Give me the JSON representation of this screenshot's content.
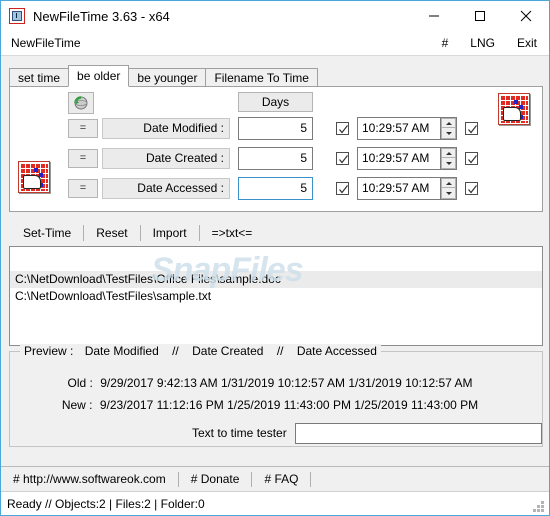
{
  "window": {
    "title": "NewFileTime 3.63 - x64",
    "app_icon": "clock-calendar-icon",
    "minimize": "minimize-icon",
    "maximize": "maximize-icon",
    "close": "close-icon"
  },
  "menubar": {
    "app_name": "NewFileTime",
    "items": [
      {
        "label": "#",
        "name": "menu-hash"
      },
      {
        "label": "LNG",
        "name": "menu-language"
      },
      {
        "label": "Exit",
        "name": "menu-exit"
      }
    ]
  },
  "tabs": [
    {
      "label": "set time",
      "active": false
    },
    {
      "label": "be older",
      "active": true
    },
    {
      "label": "be younger",
      "active": false
    },
    {
      "label": "Filename To Time",
      "active": false
    }
  ],
  "panel": {
    "refresh_icon": "globe-refresh-icon",
    "days_header": "Days",
    "calendar_icon_top_right": "calendar-hand-icon",
    "calendar_icon_bottom_left": "calendar-hand-icon",
    "rows": [
      {
        "equals_label": "=",
        "field_label": "Date Modified :",
        "days_value": "5",
        "days_focused": false,
        "time_checkbox_checked": true,
        "time_value": "10:29:57 AM",
        "apply_checkbox_checked": true
      },
      {
        "equals_label": "=",
        "field_label": "Date Created :",
        "days_value": "5",
        "days_focused": false,
        "time_checkbox_checked": true,
        "time_value": "10:29:57 AM",
        "apply_checkbox_checked": true
      },
      {
        "equals_label": "=",
        "field_label": "Date Accessed :",
        "days_value": "5",
        "days_focused": true,
        "time_checkbox_checked": true,
        "time_value": "10:29:57 AM",
        "apply_checkbox_checked": true
      }
    ]
  },
  "actions": [
    {
      "label": "Set-Time"
    },
    {
      "label": "Reset"
    },
    {
      "label": "Import"
    },
    {
      "label": "=>txt<="
    }
  ],
  "filelist": {
    "items": [
      {
        "path": "C:\\NetDownload\\TestFiles\\Office Files\\sample.doc",
        "selected": true
      },
      {
        "path": "C:\\NetDownload\\TestFiles\\sample.txt",
        "selected": false
      }
    ],
    "watermark": "SnapFiles"
  },
  "preview": {
    "legend_title": "Preview :",
    "columns": [
      "Date Modified",
      "Date Created",
      "Date Accessed"
    ],
    "separator": "//",
    "old_label": "Old :",
    "old_values": "9/29/2017 9:42:13 AM   1/31/2019 10:12:57 AM  1/31/2019 10:12:57 AM",
    "new_label": "New :",
    "new_values": "9/23/2017 11:12:16 PM  1/25/2019 11:43:00 PM  1/25/2019 11:43:00 PM",
    "tester_label": "Text to time tester",
    "tester_value": "",
    "tester_placeholder": ""
  },
  "links": [
    {
      "label": "# http://www.softwareok.com"
    },
    {
      "label": "# Donate"
    },
    {
      "label": "# FAQ"
    }
  ],
  "status": {
    "text": "Ready // Objects:2 | Files:2  | Folder:0"
  },
  "colors": {
    "window_border": "#4aa8d8",
    "panel_bg": "#f0f0f0",
    "field_bg": "#ffffff",
    "readonly_field_bg": "#ebebeb",
    "focus_border": "#3a92c8",
    "selection_bg": "#ebebeb",
    "icon_red": "#e02a22",
    "icon_blue": "#2222cc",
    "watermark": "#cfe0ea"
  }
}
